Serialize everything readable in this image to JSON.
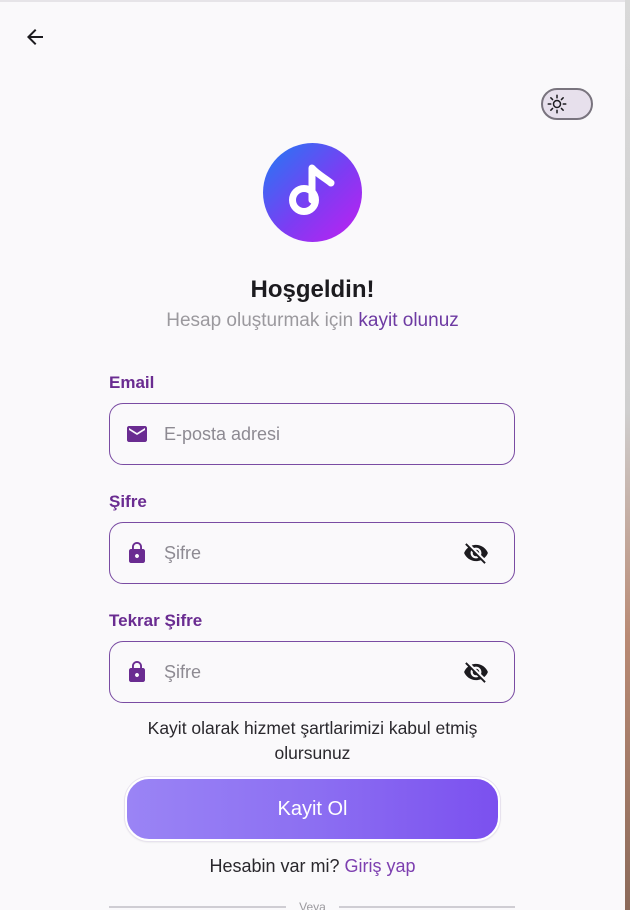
{
  "header": {
    "back_icon": "arrow-back-icon",
    "theme_icon": "sun-icon"
  },
  "brand": {
    "logo_icon": "music-note-icon",
    "gradient": [
      "#1f7cf3",
      "#7d3cf3",
      "#c21ff0"
    ]
  },
  "welcome": {
    "title": "Hoşgeldin!",
    "subtitle_prefix": "Hesap oluşturmak için",
    "subtitle_link": "kayit olunuz"
  },
  "form": {
    "email": {
      "label": "Email",
      "placeholder": "E-posta adresi",
      "icon": "mail-icon"
    },
    "password": {
      "label": "Şifre",
      "placeholder": "Şifre",
      "icon": "lock-icon",
      "toggle_icon": "visibility-off-icon"
    },
    "password_repeat": {
      "label": "Tekrar Şifre",
      "placeholder": "Şifre",
      "icon": "lock-icon",
      "toggle_icon": "visibility-off-icon"
    }
  },
  "terms": {
    "line1": "Kayit olarak hizmet şartlarimizi kabul etmiş",
    "line2": "olursunuz"
  },
  "submit": {
    "label": "Kayit Ol"
  },
  "login": {
    "prefix": "Hesabin var mi?",
    "link": "Giriş yap"
  },
  "divider": {
    "label": "Veya"
  },
  "colors": {
    "accent": "#6a2c91",
    "field_border": "#7a4ca3",
    "background": "#faf9fb"
  }
}
